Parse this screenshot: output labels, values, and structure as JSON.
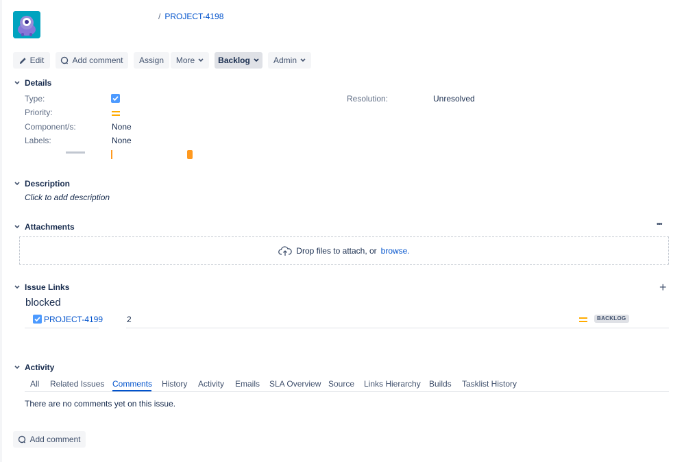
{
  "header": {
    "breadcrumb_sep": "/",
    "issue_key": "PROJECT-4198"
  },
  "toolbar": {
    "edit": "Edit",
    "add_comment": "Add comment",
    "assign": "Assign",
    "more": "More",
    "status": "Backlog",
    "admin": "Admin"
  },
  "details": {
    "title": "Details",
    "type_label": "Type:",
    "priority_label": "Priority:",
    "components_label": "Component/s:",
    "components_value": "None",
    "labels_label": "Labels:",
    "labels_value": "None",
    "resolution_label": "Resolution:",
    "resolution_value": "Unresolved"
  },
  "description": {
    "title": "Description",
    "placeholder": "Click to add description"
  },
  "attachments": {
    "title": "Attachments",
    "menu": "•••",
    "drop_text": "Drop files to attach, or",
    "browse": "browse."
  },
  "issue_links": {
    "title": "Issue Links",
    "add": "+",
    "relation": "blocked",
    "links": [
      {
        "key": "PROJECT-4199",
        "summary": "2",
        "status": "BACKLOG"
      }
    ]
  },
  "activity": {
    "title": "Activity",
    "tabs": [
      "All",
      "Related Issues",
      "Comments",
      "History",
      "Activity",
      "Emails",
      "SLA Overview",
      "Source",
      "Links Hierarchy",
      "Builds",
      "Tasklist History"
    ],
    "active_tab": "Comments",
    "empty_text": "There are no comments yet on this issue.",
    "add_comment": "Add comment"
  },
  "colors": {
    "accent": "#0052cc",
    "priority_medium": "#ffab00",
    "task_icon": "#4c9aff"
  }
}
